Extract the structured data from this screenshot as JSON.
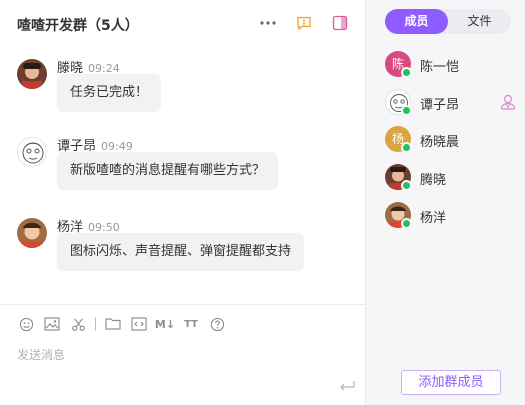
{
  "header": {
    "title": "喳喳开发群（5人）"
  },
  "messages": [
    {
      "sender": "滕晓",
      "time": "09:24",
      "text": "任务已完成！"
    },
    {
      "sender": "谭子昂",
      "time": "09:49",
      "text": "新版喳喳的消息提醒有哪些方式？"
    },
    {
      "sender": "杨洋",
      "time": "09:50",
      "text": "图标闪烁、声音提醒、弹窗提醒都支持"
    }
  ],
  "composer": {
    "placeholder": "发送消息",
    "toolbar_icons": [
      "emoji-icon",
      "image-icon",
      "scissors-icon",
      "folder-icon",
      "code-icon",
      "markdown-icon",
      "text-format-icon",
      "help-icon"
    ],
    "markdown_label": "M↓",
    "textformat_label": "TT"
  },
  "panel": {
    "tabs": [
      {
        "label": "成员",
        "active": true
      },
      {
        "label": "文件",
        "active": false
      }
    ],
    "members": [
      {
        "name": "陈一恺",
        "avatar_text": "陈",
        "avatar_color": "#d9487f",
        "online": true,
        "owner": false
      },
      {
        "name": "谭子昂",
        "avatar_text": "",
        "avatar_color": "#ffffff",
        "online": true,
        "owner": true
      },
      {
        "name": "杨晓晨",
        "avatar_text": "杨",
        "avatar_color": "#d9a53f",
        "online": true,
        "owner": false
      },
      {
        "name": "腾晓",
        "avatar_text": "",
        "avatar_color": "#7a4a3a",
        "online": true,
        "owner": false
      },
      {
        "name": "杨洋",
        "avatar_text": "",
        "avatar_color": "#9c6a40",
        "online": true,
        "owner": false
      }
    ],
    "add_member_label": "添加群成员"
  },
  "colors": {
    "accent": "#8e5cff",
    "online": "#22c35e",
    "notice_icon": "#f0a020",
    "panel_icon": "#e05aa0"
  }
}
